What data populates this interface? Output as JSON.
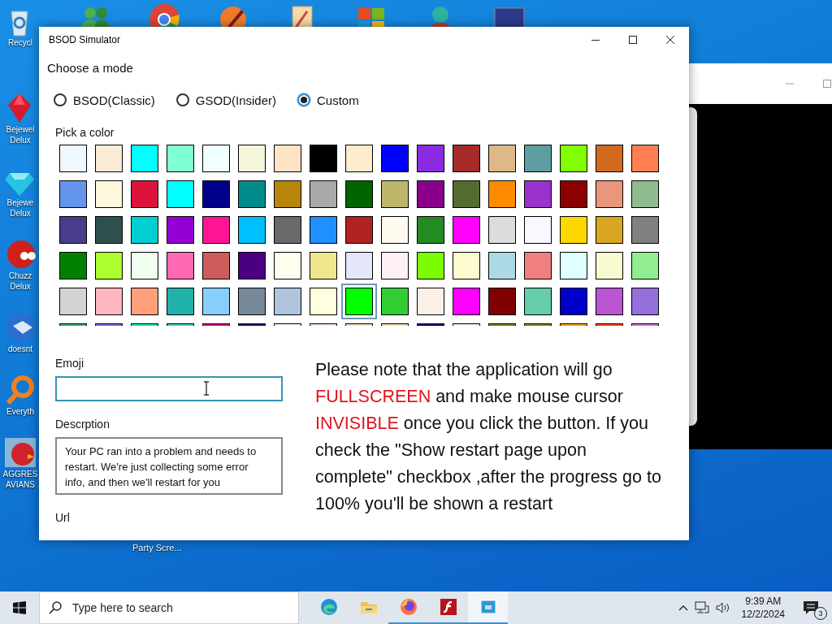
{
  "desktop": {
    "top_row": [
      {
        "kind": "people"
      },
      {
        "kind": "browser"
      },
      {
        "kind": "paint"
      },
      {
        "kind": "document"
      },
      {
        "kind": "flag"
      },
      {
        "kind": "figure"
      },
      {
        "kind": "monitor"
      }
    ],
    "left_column": [
      {
        "kind": "recycle",
        "label": "Recycl"
      },
      {
        "kind": "jewel",
        "label": "Bejewel Delux"
      },
      {
        "kind": "diamond",
        "label": "Bejewe Delux"
      },
      {
        "kind": "blob",
        "label": "Chuzz Delux"
      },
      {
        "kind": "globe",
        "label": "doesnt"
      },
      {
        "kind": "magnifier",
        "label": "Everyth"
      },
      {
        "kind": "bird",
        "label": "AGGRES AVIANS"
      }
    ],
    "bottom_label": "Party Scre..."
  },
  "window": {
    "title": "BSOD Simulator",
    "mode_label": "Choose a mode",
    "modes": [
      {
        "label": "BSOD(Classic)",
        "selected": false
      },
      {
        "label": "GSOD(Insider)",
        "selected": false
      },
      {
        "label": "Custom",
        "selected": true
      }
    ],
    "color_label": "Pick a color",
    "colors": [
      {
        "color": "#f0f8ff",
        "selected": false
      },
      {
        "color": "#faebd7",
        "selected": false
      },
      {
        "color": "#00ffff",
        "selected": false
      },
      {
        "color": "#7fffd4",
        "selected": false
      },
      {
        "color": "#f0ffff",
        "selected": false
      },
      {
        "color": "#f5f5dc",
        "selected": false
      },
      {
        "color": "#ffe4c4",
        "selected": false
      },
      {
        "color": "#000000",
        "selected": false
      },
      {
        "color": "#ffebcd",
        "selected": false
      },
      {
        "color": "#0000ff",
        "selected": false
      },
      {
        "color": "#8a2be2",
        "selected": false
      },
      {
        "color": "#a52a2a",
        "selected": false
      },
      {
        "color": "#deb887",
        "selected": false
      },
      {
        "color": "#5f9ea0",
        "selected": false
      },
      {
        "color": "#7fff00",
        "selected": false
      },
      {
        "color": "#d2691e",
        "selected": false
      },
      {
        "color": "#ff7f50",
        "selected": false
      },
      {
        "color": "#6495ed",
        "selected": false
      },
      {
        "color": "#fff8dc",
        "selected": false
      },
      {
        "color": "#dc143c",
        "selected": false
      },
      {
        "color": "#00ffff",
        "selected": false
      },
      {
        "color": "#00008b",
        "selected": false
      },
      {
        "color": "#008b8b",
        "selected": false
      },
      {
        "color": "#b8860b",
        "selected": false
      },
      {
        "color": "#a9a9a9",
        "selected": false
      },
      {
        "color": "#006400",
        "selected": false
      },
      {
        "color": "#bdb76b",
        "selected": false
      },
      {
        "color": "#8b008b",
        "selected": false
      },
      {
        "color": "#556b2f",
        "selected": false
      },
      {
        "color": "#ff8c00",
        "selected": false
      },
      {
        "color": "#9932cc",
        "selected": false
      },
      {
        "color": "#8b0000",
        "selected": false
      },
      {
        "color": "#e9967a",
        "selected": false
      },
      {
        "color": "#8fbc8f",
        "selected": false
      },
      {
        "color": "#483d8b",
        "selected": false
      },
      {
        "color": "#2f4f4f",
        "selected": false
      },
      {
        "color": "#00ced1",
        "selected": false
      },
      {
        "color": "#9400d3",
        "selected": false
      },
      {
        "color": "#ff1493",
        "selected": false
      },
      {
        "color": "#00bfff",
        "selected": false
      },
      {
        "color": "#696969",
        "selected": false
      },
      {
        "color": "#1e90ff",
        "selected": false
      },
      {
        "color": "#b22222",
        "selected": false
      },
      {
        "color": "#fffaf0",
        "selected": false
      },
      {
        "color": "#228b22",
        "selected": false
      },
      {
        "color": "#ff00ff",
        "selected": false
      },
      {
        "color": "#dcdcdc",
        "selected": false
      },
      {
        "color": "#f8f8ff",
        "selected": false
      },
      {
        "color": "#ffd700",
        "selected": false
      },
      {
        "color": "#daa520",
        "selected": false
      },
      {
        "color": "#808080",
        "selected": false
      },
      {
        "color": "#008000",
        "selected": false
      },
      {
        "color": "#adff2f",
        "selected": false
      },
      {
        "color": "#f0fff0",
        "selected": false
      },
      {
        "color": "#ff69b4",
        "selected": false
      },
      {
        "color": "#cd5c5c",
        "selected": false
      },
      {
        "color": "#4b0082",
        "selected": false
      },
      {
        "color": "#fffff0",
        "selected": false
      },
      {
        "color": "#f0e68c",
        "selected": false
      },
      {
        "color": "#e6e6fa",
        "selected": false
      },
      {
        "color": "#fff0f5",
        "selected": false
      },
      {
        "color": "#7cfc00",
        "selected": false
      },
      {
        "color": "#fffacd",
        "selected": false
      },
      {
        "color": "#add8e6",
        "selected": false
      },
      {
        "color": "#f08080",
        "selected": false
      },
      {
        "color": "#e0ffff",
        "selected": false
      },
      {
        "color": "#fafad2",
        "selected": false
      },
      {
        "color": "#90ee90",
        "selected": false
      },
      {
        "color": "#d3d3d3",
        "selected": false
      },
      {
        "color": "#ffb6c1",
        "selected": false
      },
      {
        "color": "#ffa07a",
        "selected": false
      },
      {
        "color": "#20b2aa",
        "selected": false
      },
      {
        "color": "#87cefa",
        "selected": false
      },
      {
        "color": "#778899",
        "selected": false
      },
      {
        "color": "#b0c4de",
        "selected": false
      },
      {
        "color": "#ffffe0",
        "selected": false
      },
      {
        "color": "#00ff00",
        "selected": true
      },
      {
        "color": "#32cd32",
        "selected": false
      },
      {
        "color": "#faf0e6",
        "selected": false
      },
      {
        "color": "#ff00ff",
        "selected": false
      },
      {
        "color": "#800000",
        "selected": false
      },
      {
        "color": "#66cdaa",
        "selected": false
      },
      {
        "color": "#0000cd",
        "selected": false
      },
      {
        "color": "#ba55d3",
        "selected": false
      },
      {
        "color": "#9370db",
        "selected": false
      },
      {
        "color": "#3cb371",
        "selected": false
      },
      {
        "color": "#7b68ee",
        "selected": false
      },
      {
        "color": "#00fa9a",
        "selected": false
      },
      {
        "color": "#48d1cc",
        "selected": false
      },
      {
        "color": "#c71585",
        "selected": false
      },
      {
        "color": "#191970",
        "selected": false
      },
      {
        "color": "#f5fffa",
        "selected": false
      },
      {
        "color": "#ffe4e1",
        "selected": false
      },
      {
        "color": "#ffe4b5",
        "selected": false
      },
      {
        "color": "#ffdead",
        "selected": false
      },
      {
        "color": "#000080",
        "selected": false
      },
      {
        "color": "#fdf5e6",
        "selected": false
      },
      {
        "color": "#808000",
        "selected": false
      },
      {
        "color": "#6b8e23",
        "selected": false
      },
      {
        "color": "#ffa500",
        "selected": false
      },
      {
        "color": "#ff4500",
        "selected": false
      },
      {
        "color": "#da70d6",
        "selected": false
      }
    ],
    "emoji": {
      "label": "Emoji"
    },
    "description": {
      "label": "Descrption",
      "value": "Your PC ran into a problem and needs to restart. We're just collecting some error info, and then we'll restart for you"
    },
    "url": {
      "label": "Url"
    },
    "notice": [
      {
        "text": "Please note that the application will go ",
        "highlight": false
      },
      {
        "text": "FULLSCREEN",
        "highlight": true
      },
      {
        "text": " and make mouse cursor ",
        "highlight": false
      },
      {
        "text": "INVISIBLE",
        "highlight": true
      },
      {
        "text": " once you click the button. If you check the \"Show restart page upon complete\" checkbox ,after the progress go to 100% you'll be shown a restart",
        "highlight": false
      }
    ]
  },
  "taskbar": {
    "search": {
      "placeholder": "Type here to search"
    },
    "apps": [
      {
        "kind": "edge",
        "running": false,
        "selected": false
      },
      {
        "kind": "folder",
        "running": false,
        "selected": false
      },
      {
        "kind": "firefox",
        "running": true,
        "selected": false
      },
      {
        "kind": "flash",
        "running": true,
        "selected": false
      },
      {
        "kind": "app",
        "running": true,
        "selected": true
      }
    ],
    "time": "9:39 AM",
    "date": "12/2/2024",
    "notifications": "3"
  }
}
